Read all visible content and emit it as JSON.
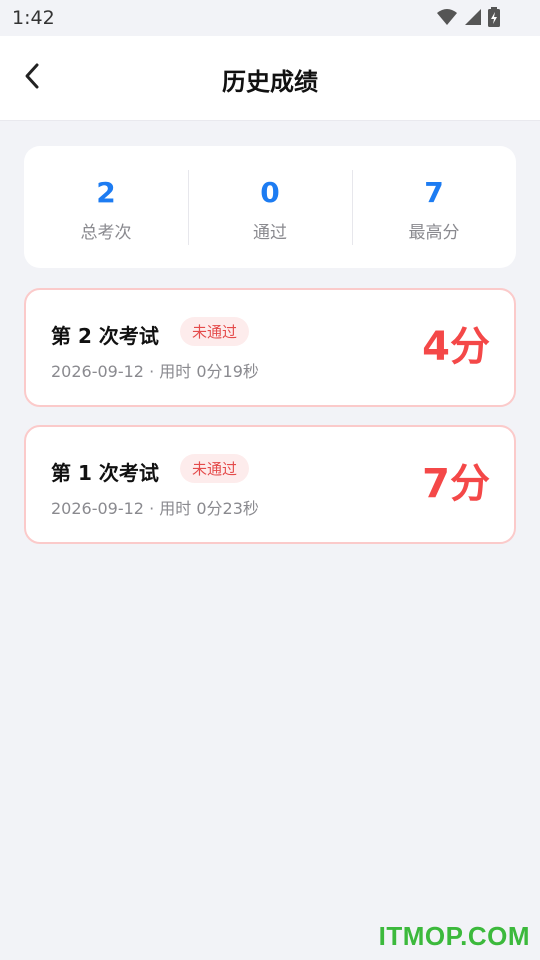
{
  "status_bar": {
    "time": "1:42",
    "icons": [
      "wifi-icon",
      "signal-icon",
      "battery-charging-icon"
    ]
  },
  "header": {
    "back_icon": "back-arrow-icon",
    "title": "历史成绩"
  },
  "summary": {
    "stats": [
      {
        "value": "2",
        "label": "总考次"
      },
      {
        "value": "0",
        "label": "通过"
      },
      {
        "value": "7",
        "label": "最高分"
      }
    ]
  },
  "records": [
    {
      "title": "第 2 次考试",
      "status": "未通过",
      "meta": "2026-09-12 · 用时 0分19秒",
      "score": "4分"
    },
    {
      "title": "第 1 次考试",
      "status": "未通过",
      "meta": "2026-09-12 · 用时 0分23秒",
      "score": "7分"
    }
  ],
  "watermark": "ITMOP.COM",
  "colors": {
    "accent": "#1d7cf2",
    "fail": "#f44848",
    "fail_badge_bg": "#fdecec",
    "fail_border": "#fbcaca"
  }
}
